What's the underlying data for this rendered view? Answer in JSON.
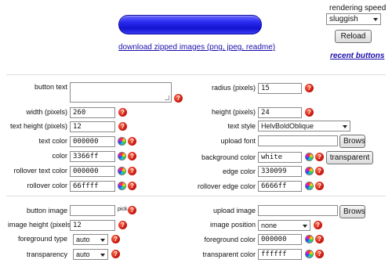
{
  "preview": {
    "button_color": "#3366ff"
  },
  "download_link": "download zipped images (png, jpeg, readme)",
  "rendering_speed": {
    "label": "rendering speed",
    "value": "sluggish"
  },
  "reload_label": "Reload",
  "recent_buttons_label": "recent buttons",
  "left_fields": {
    "button_text": {
      "label": "button text",
      "value": ""
    },
    "width": {
      "label": "width (pixels)",
      "value": "260"
    },
    "text_height": {
      "label": "text height (pixels)",
      "value": "12"
    },
    "text_color": {
      "label": "text color",
      "value": "000000"
    },
    "color": {
      "label": "color",
      "value": "3366ff"
    },
    "rollover_text_color": {
      "label": "rollover text color",
      "value": "000000"
    },
    "rollover_color": {
      "label": "rollover color",
      "value": "66ffff"
    }
  },
  "right_fields": {
    "radius": {
      "label": "radius (pixels)",
      "value": "15"
    },
    "height": {
      "label": "height (pixels)",
      "value": "24"
    },
    "text_style": {
      "label": "text style",
      "value": "HelvBoldOblique"
    },
    "upload_font": {
      "label": "upload font",
      "value": "",
      "browse": "Browse..."
    },
    "background_color": {
      "label": "background color",
      "value": "white",
      "transparent_label": "transparent"
    },
    "edge_color": {
      "label": "edge color",
      "value": "330099"
    },
    "rollover_edge_color": {
      "label": "rollover edge color",
      "value": "6666ff"
    }
  },
  "image_section": {
    "button_image": {
      "label": "button image",
      "value": "",
      "pick_label": "pick"
    },
    "image_height": {
      "label": "image height (pixels)",
      "value": "12"
    },
    "foreground_type": {
      "label": "foreground type",
      "value": "auto"
    },
    "transparency": {
      "label": "transparency",
      "value": "auto"
    },
    "upload_image": {
      "label": "upload image",
      "value": "",
      "browse": "Browse..."
    },
    "image_position": {
      "label": "image position",
      "value": "none"
    },
    "foreground_color": {
      "label": "foreground color",
      "value": "000000"
    },
    "transparent_color": {
      "label": "transparent color",
      "value": "ffffff"
    }
  },
  "help_icon_glyph": "?"
}
